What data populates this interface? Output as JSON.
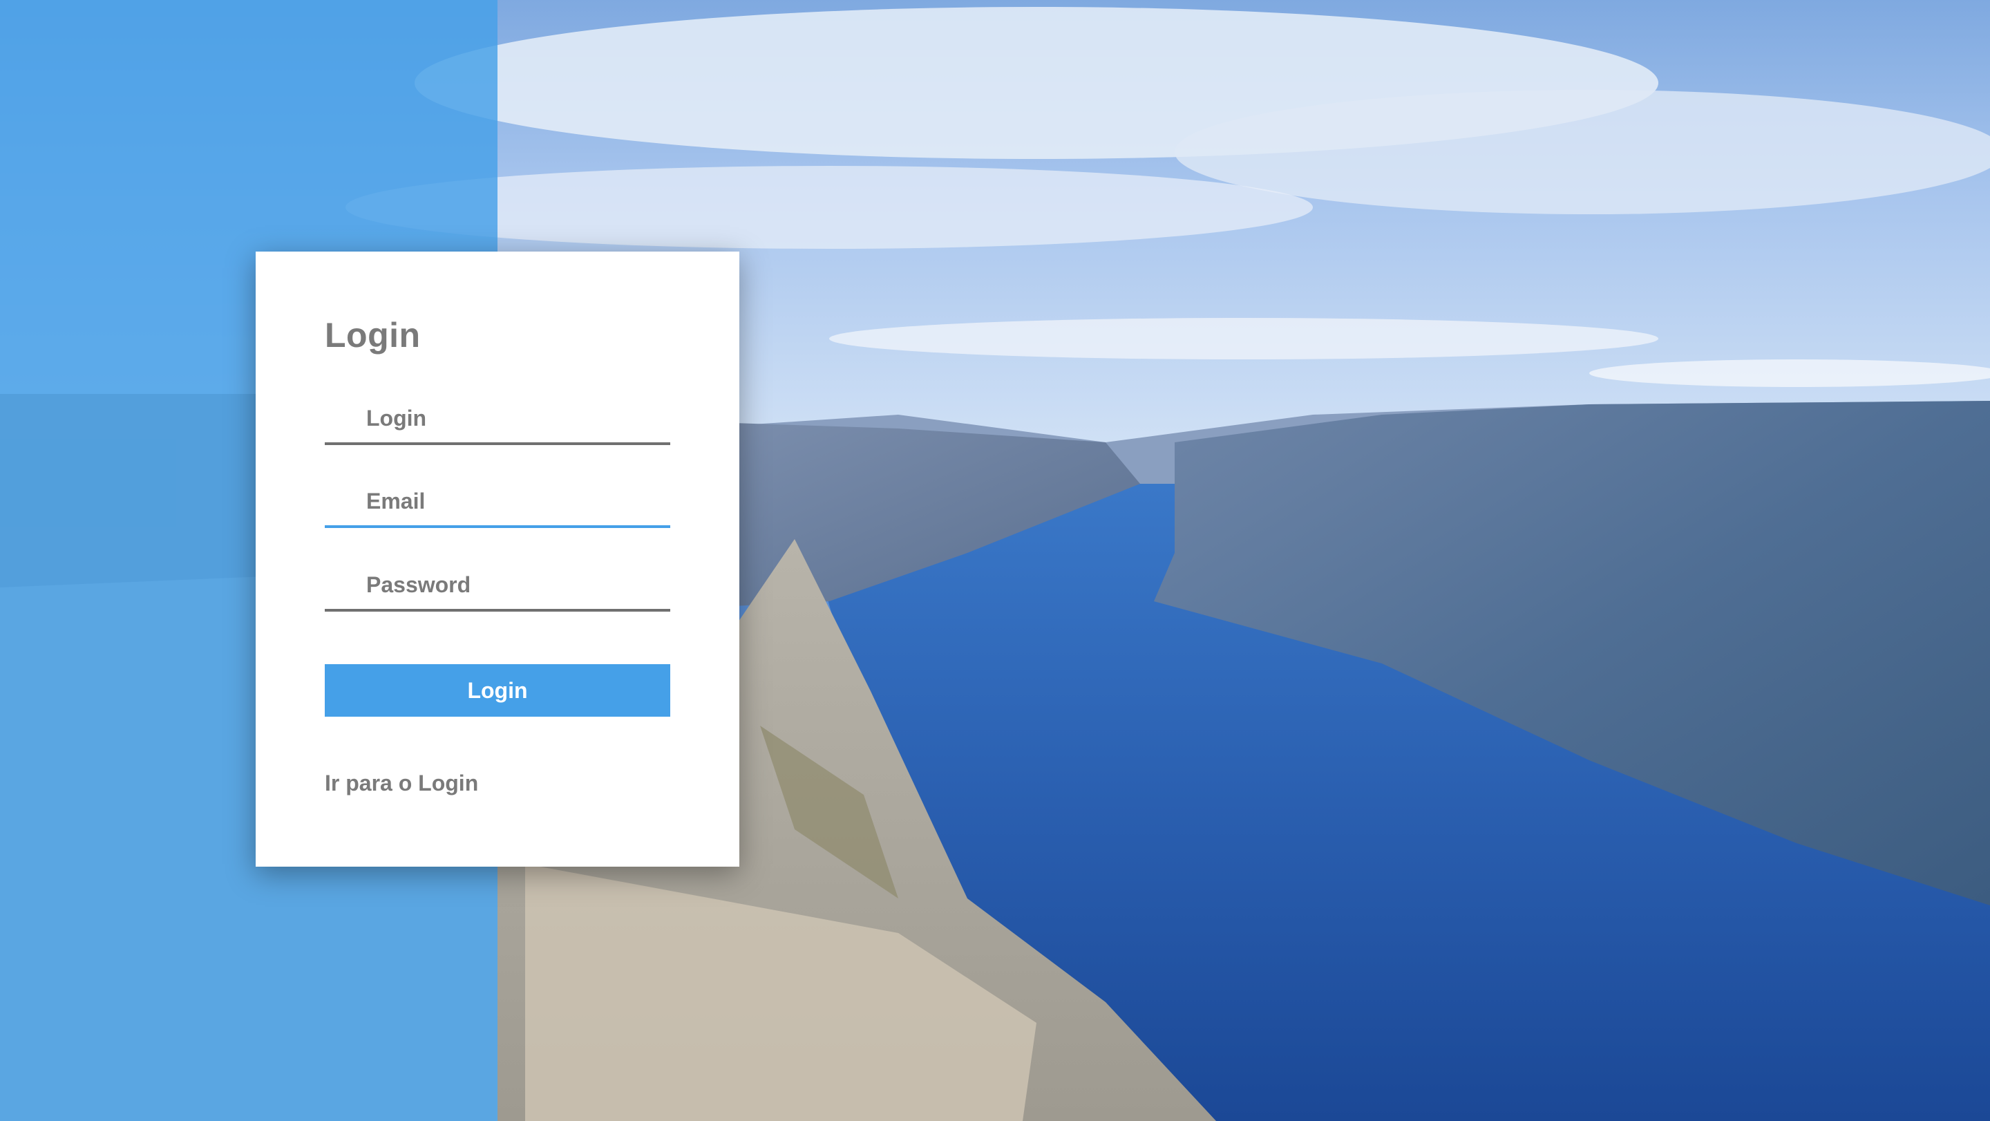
{
  "form": {
    "title": "Login",
    "fields": {
      "login_placeholder": "Login",
      "email_placeholder": "Email",
      "password_placeholder": "Password"
    },
    "submit_label": "Login",
    "switch_link": "Ir para o Login"
  },
  "colors": {
    "accent": "#45a0e8",
    "card_background": "#ffffff",
    "text_muted": "#7a7a7a"
  },
  "background": {
    "scene": "fjord-landscape-photo"
  }
}
